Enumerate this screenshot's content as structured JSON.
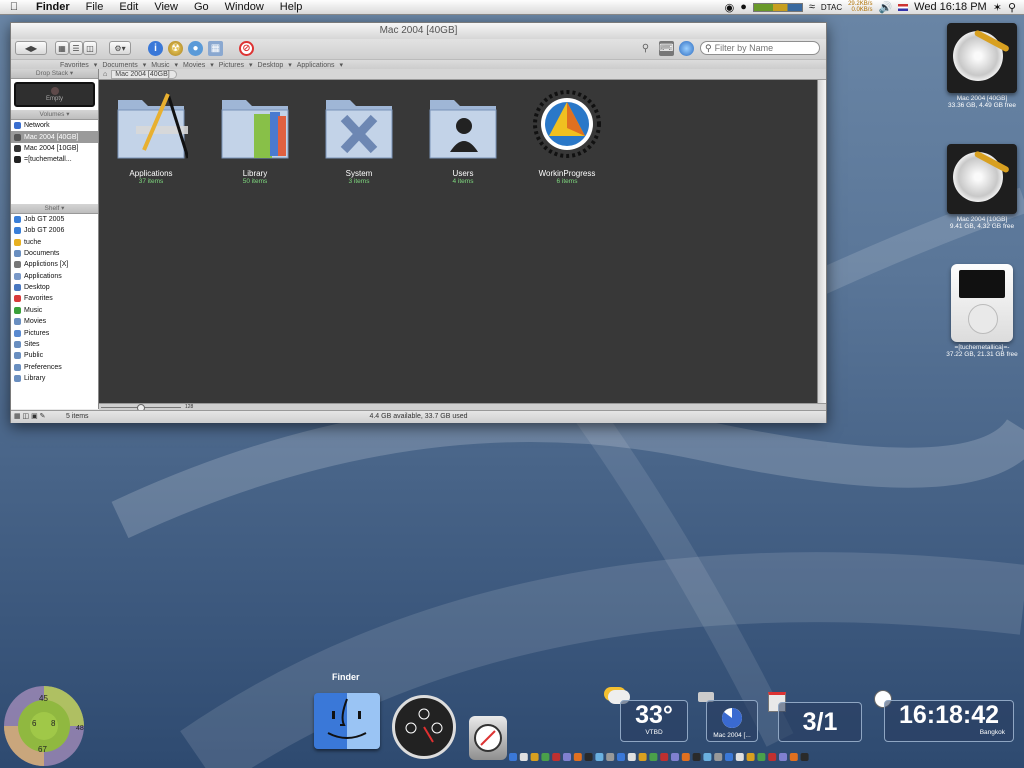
{
  "menubar": {
    "app": "Finder",
    "menus": [
      "File",
      "Edit",
      "View",
      "Go",
      "Window",
      "Help"
    ],
    "net_up": "29.2KB/s",
    "net_down": "0.0KB/s",
    "carrier": "DTAC",
    "clock": "Wed 16:18 PM"
  },
  "window": {
    "title": "Mac 2004 [40GB]",
    "search_placeholder": "Filter by Name",
    "favorites": [
      "Favorites",
      "Documents",
      "Music",
      "Movies",
      "Pictures",
      "Desktop",
      "Applications"
    ],
    "path": "Mac 2004 [40GB]",
    "sidebar": {
      "drop_stack_header": "Drop Stack",
      "drop_stack_text": "Empty",
      "volumes_header": "Volumes",
      "volumes": [
        {
          "label": "Network",
          "color": "#3a6fd0"
        },
        {
          "label": "Mac 2004 [40GB]",
          "color": "#555555",
          "selected": true
        },
        {
          "label": "Mac 2004 [10GB]",
          "color": "#333333"
        },
        {
          "label": "=[tuchemetall...",
          "color": "#222222"
        }
      ],
      "shelf_header": "Shelf",
      "shelf": [
        {
          "label": "Job GT 2005",
          "color": "#3a7fd8"
        },
        {
          "label": "Job GT 2006",
          "color": "#3a7fd8"
        },
        {
          "label": "tuche",
          "color": "#e8b020"
        },
        {
          "label": "Documents",
          "color": "#6a8fc0"
        },
        {
          "label": "Applictions [X]",
          "color": "#777777"
        },
        {
          "label": "Applications",
          "color": "#7a99c8"
        },
        {
          "label": "Desktop",
          "color": "#4a78c0"
        },
        {
          "label": "Favorites",
          "color": "#d83a3a"
        },
        {
          "label": "Music",
          "color": "#3aa03a"
        },
        {
          "label": "Movies",
          "color": "#6a8fc0"
        },
        {
          "label": "Pictures",
          "color": "#5a8ad0"
        },
        {
          "label": "Sites",
          "color": "#6a8fc0"
        },
        {
          "label": "Public",
          "color": "#6a8fc0"
        },
        {
          "label": "Preferences",
          "color": "#6a8fc0"
        },
        {
          "label": "Library",
          "color": "#6a8fc0"
        }
      ]
    },
    "items": [
      {
        "name": "Applications",
        "count": "37 items",
        "icon": "applications-folder-icon"
      },
      {
        "name": "Library",
        "count": "50 items",
        "icon": "library-folder-icon"
      },
      {
        "name": "System",
        "count": "3 items",
        "icon": "system-folder-icon"
      },
      {
        "name": "Users",
        "count": "4 items",
        "icon": "users-folder-icon"
      },
      {
        "name": "WorkinProgress",
        "count": "6 items",
        "icon": "workinprogress-icon"
      }
    ],
    "zoom_value": "128",
    "status_count": "5 items",
    "status_space": "4.4 GB available, 33.7 GB used"
  },
  "desktop_icons": [
    {
      "name": "Mac 2004 [40GB]",
      "detail": "33.36 GB, 4.49 GB free"
    },
    {
      "name": "Mac 2004 [10GB]",
      "detail": "9.41 GB, 4.32 GB free"
    },
    {
      "name": "=[tuchemetallica]=-",
      "detail": "37.22 GB, 21.31 GB free"
    }
  ],
  "dock": {
    "tooltip": "Finder"
  },
  "widgets": {
    "ring": {
      "top": "45",
      "left": "6",
      "right": "8",
      "side": "48",
      "bottom": "67"
    },
    "weather": {
      "temp": "33°",
      "station": "VTBD"
    },
    "drive": {
      "label": "Mac 2004 [..."
    },
    "date": {
      "value": "3/1"
    },
    "clock": {
      "time": "16:18:42",
      "city": "Bangkok"
    }
  }
}
